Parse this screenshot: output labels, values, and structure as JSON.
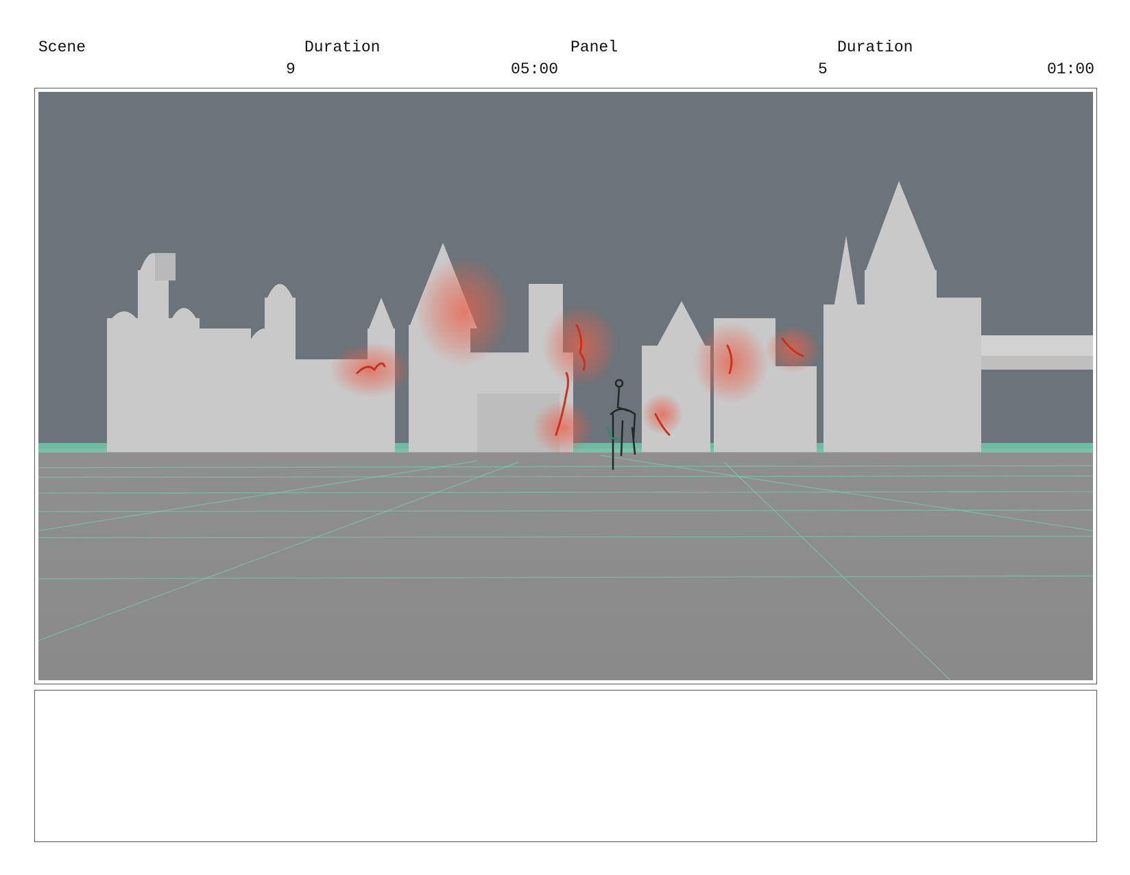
{
  "header": {
    "scene_label": "Scene",
    "scene_value": "9",
    "scene_duration_label": "Duration",
    "scene_duration_value": "05:00",
    "panel_label": "Panel",
    "panel_value": "5",
    "panel_duration_label": "Duration",
    "panel_duration_value": "01:00"
  },
  "panel": {
    "notes_text": ""
  },
  "colors": {
    "sky": "#6b747a",
    "ground": "#8c8c8c",
    "grid": "#6fd3b0",
    "building": "#c9c9c9",
    "fire": "#e0513a"
  }
}
